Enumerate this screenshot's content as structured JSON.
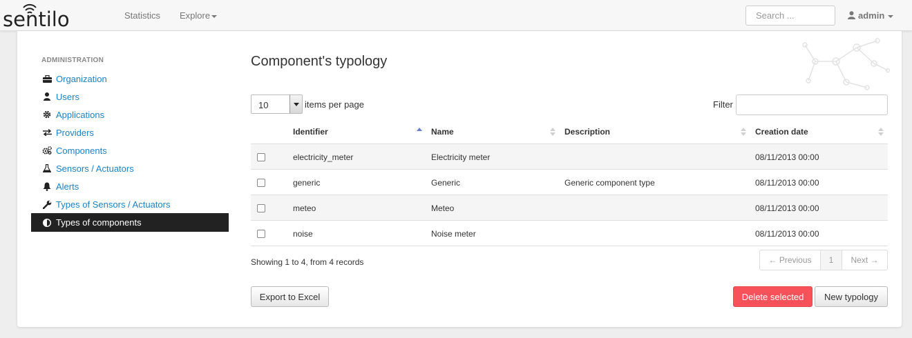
{
  "navbar": {
    "logo_text": "sentilo",
    "links": [
      "Statistics",
      "Explore"
    ],
    "search_placeholder": "Search ...",
    "user": "admin"
  },
  "sidebar": {
    "header": "ADMINISTRATION",
    "items": [
      {
        "label": "Organization",
        "icon": "briefcase-icon"
      },
      {
        "label": "Users",
        "icon": "user-icon"
      },
      {
        "label": "Applications",
        "icon": "gear-icon"
      },
      {
        "label": "Providers",
        "icon": "exchange-icon"
      },
      {
        "label": "Components",
        "icon": "gears-icon"
      },
      {
        "label": "Sensors / Actuators",
        "icon": "flask-icon"
      },
      {
        "label": "Alerts",
        "icon": "bell-icon"
      },
      {
        "label": "Types of Sensors / Actuators",
        "icon": "wrench-icon"
      },
      {
        "label": "Types of components",
        "icon": "adjust-icon",
        "active": true
      }
    ]
  },
  "main": {
    "title": "Component's typology",
    "page_length": "10",
    "page_length_label": "items per page",
    "filter_label": "Filter",
    "columns": [
      "Identifier",
      "Name",
      "Description",
      "Creation date"
    ],
    "rows": [
      {
        "identifier": "electricity_meter",
        "name": "Electricity meter",
        "description": "",
        "date": "08/11/2013 00:00"
      },
      {
        "identifier": "generic",
        "name": "Generic",
        "description": "Generic component type",
        "date": "08/11/2013 00:00"
      },
      {
        "identifier": "meteo",
        "name": "Meteo",
        "description": "",
        "date": "08/11/2013 00:00"
      },
      {
        "identifier": "noise",
        "name": "Noise meter",
        "description": "",
        "date": "08/11/2013 00:00"
      }
    ],
    "showing": "Showing 1 to 4, from 4 records",
    "pager": {
      "previous": "← Previous",
      "page": "1",
      "next": "Next →"
    },
    "buttons": {
      "export": "Export to Excel",
      "delete": "Delete selected",
      "new": "New typology"
    }
  },
  "colors": {
    "link": "#1b82c4",
    "active_bg": "#222222",
    "danger": "#f7525a",
    "sort_active": "#6a7bd1"
  }
}
